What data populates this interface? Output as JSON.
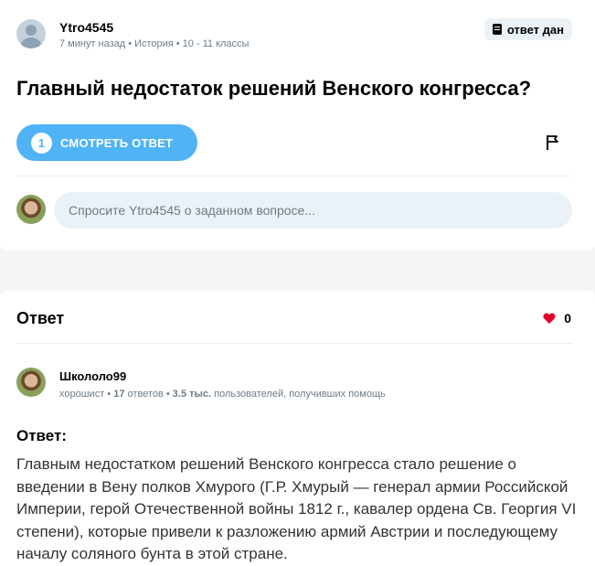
{
  "question": {
    "author": "Ytro4545",
    "time": "7 минут назад",
    "subject": "История",
    "grade": "10 - 11 классы",
    "status_badge": "ответ дан",
    "title": "Главный недостаток решений Венского конгресса?",
    "see_answer_count": "1",
    "see_answer_label": "СМОТРЕТЬ ОТВЕТ",
    "ask_placeholder": "Спросите Ytro4545 о заданном вопросе..."
  },
  "answer": {
    "heading": "Ответ",
    "likes": "0",
    "author": "Школоло99",
    "rank": "хорошист",
    "answers_count": "17",
    "answers_label": "ответов",
    "helped_count": "3.5 тыс.",
    "helped_label": "пользователей, получивших помощь",
    "label": "Ответ:",
    "text": "Главным недостатком решений Венского конгресса стало решение о введении в Вену полков Хмурого (Г.Р. Хмурый — генерал армии Российской Империи, герой Отечественной войны 1812 г., кавалер ордена Св. Георгия VI степени), которые привели к разложению армий Австрии и последующему началу соляного бунта в этой стране."
  },
  "colors": {
    "accent_blue": "#4fb3f6",
    "heart_red": "#e0002b",
    "muted_text": "#6d7b88"
  }
}
